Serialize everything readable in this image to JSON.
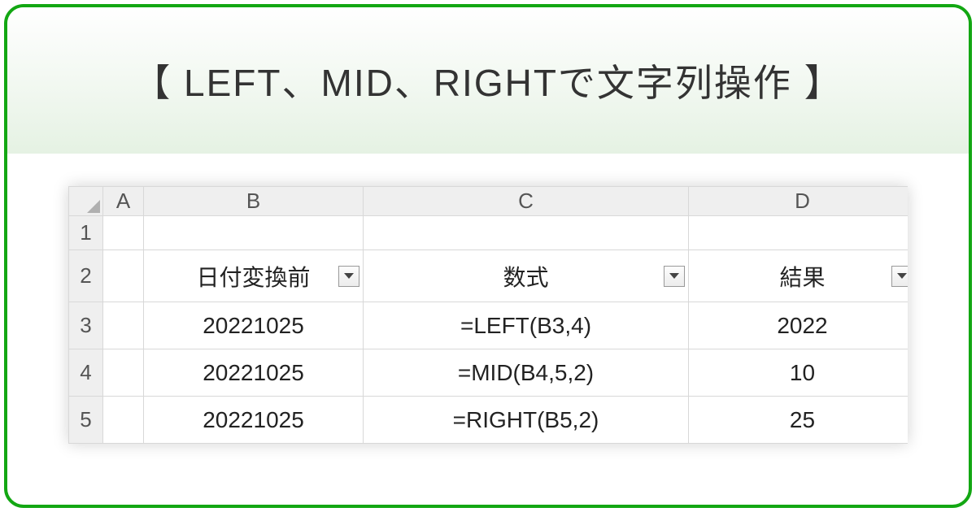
{
  "title": "【 LEFT、MID、RIGHTで文字列操作 】",
  "columns": {
    "a": "A",
    "b": "B",
    "c": "C",
    "d": "D"
  },
  "row_numbers": [
    "1",
    "2",
    "3",
    "4",
    "5"
  ],
  "headers": {
    "b": "日付変換前",
    "c": "数式",
    "d": "結果"
  },
  "rows": [
    {
      "b": "20221025",
      "c": "=LEFT(B3,4)",
      "d": "2022"
    },
    {
      "b": "20221025",
      "c": "=MID(B4,5,2)",
      "d": "10"
    },
    {
      "b": "20221025",
      "c": "=RIGHT(B5,2)",
      "d": "25"
    }
  ]
}
